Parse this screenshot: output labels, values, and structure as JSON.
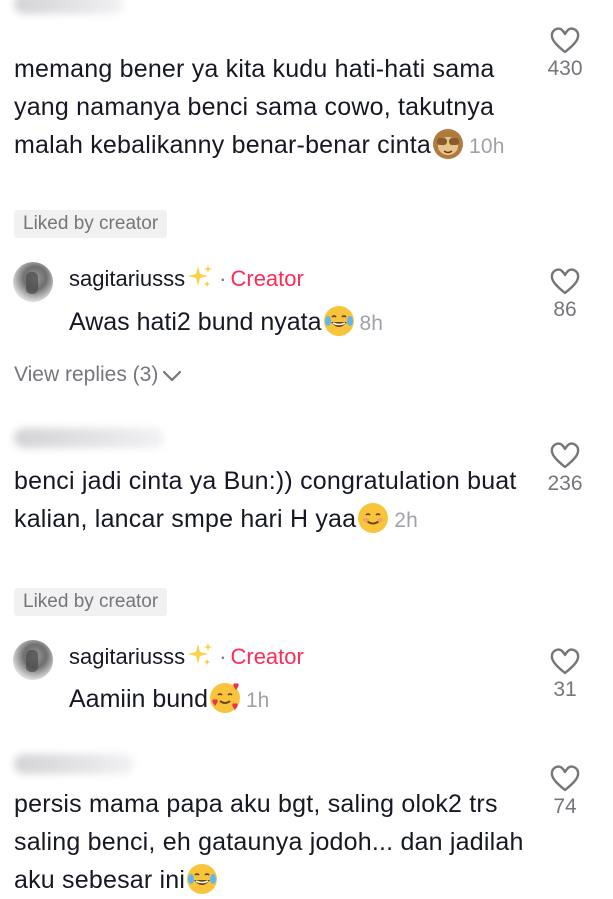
{
  "comments": [
    {
      "text": "memang bener ya kita kudu hati-hati sama yang namanya benci sama cowo, takutnya malah kebalikanny benar-benar cinta",
      "emoji": "see-no-evil-monkey",
      "time": "10h",
      "likes": "430",
      "badge": "Liked by creator",
      "reply": {
        "username": "sagitariusss",
        "sparkle_icon": "sparkles-emoji",
        "separator": "·",
        "role": "Creator",
        "text": "Awas hati2 bund nyata",
        "emoji": "tears-of-joy",
        "time": "8h",
        "likes": "86"
      },
      "view_replies": "View replies (3)"
    },
    {
      "text": "benci jadi cinta ya Bun:)) congratulation buat kalian, lancar smpe hari H yaa",
      "emoji": "smiling-face",
      "time": "2h",
      "likes": "236",
      "badge": "Liked by creator",
      "reply": {
        "username": "sagitariusss",
        "sparkle_icon": "sparkles-emoji",
        "separator": "·",
        "role": "Creator",
        "text": "Aamiin bund",
        "emoji": "smiling-face-with-hearts",
        "time": "1h",
        "likes": "31"
      }
    },
    {
      "text": "persis mama papa aku bgt, saling olok2 trs saling benci, eh gataunya jodoh... dan jadilah aku sebesar ini",
      "emoji": "tears-of-joy",
      "likes": "74"
    }
  ],
  "colors": {
    "text": "#161823",
    "secondary": "#75767b",
    "time": "#a1a2a7",
    "creator_accent": "#fe2c55",
    "badge_bg": "#f1f1f2"
  }
}
